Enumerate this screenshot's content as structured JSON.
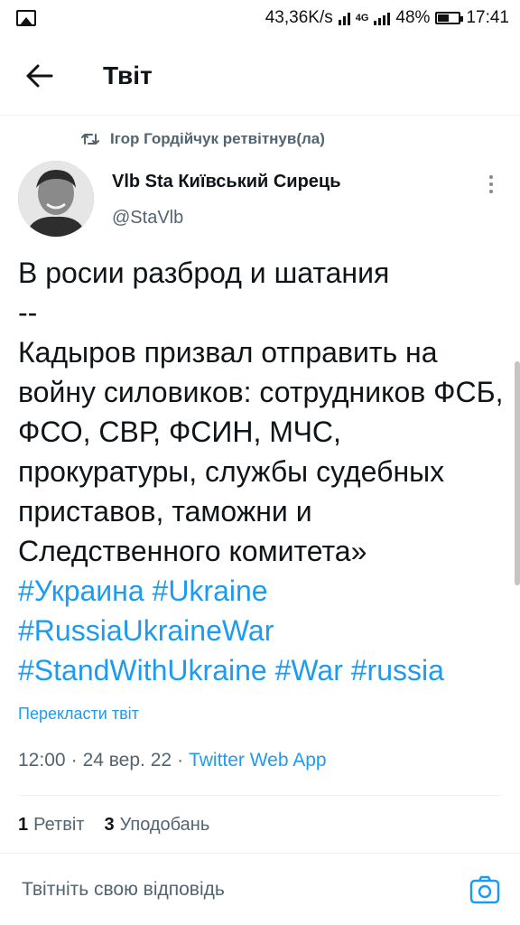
{
  "status_bar": {
    "speed": "43,36K/s",
    "network": "4G",
    "battery": "48%",
    "time": "17:41"
  },
  "header": {
    "title": "Твіт",
    "back_icon": "arrow-left-icon"
  },
  "retweet": {
    "text": "Ігор Гордійчук ретвітнув(ла)",
    "icon": "retweet-icon"
  },
  "author": {
    "name": "Vlb Sta Київський Сирець",
    "handle": "@StaVlb"
  },
  "tweet": {
    "text": "В росии разброд и шатания\n--\nКадыров призвал отправить на войну силовиков: сотрудников ФСБ, ФСО, СВР, ФСИН, МЧС, прокуратуры, службы судебных приставов, таможни и Следственного комитета»",
    "hashtags": {
      "line1": [
        "#Украина",
        "#Ukraine"
      ],
      "line2": [
        "#RussiaUkraineWar"
      ],
      "line3": [
        "#StandWithUkraine",
        "#War",
        "#russia"
      ]
    },
    "translate_label": "Перекласти твіт"
  },
  "meta": {
    "time": "12:00",
    "date": "24 вер. 22",
    "sep": "·",
    "app": "Twitter Web App"
  },
  "stats": {
    "retweets_count": "1",
    "retweets_label": "Ретвіт",
    "likes_count": "3",
    "likes_label": "Уподобань"
  },
  "reply": {
    "placeholder": "Твітніть свою відповідь",
    "camera_icon": "camera-icon"
  },
  "colors": {
    "accent": "#1d9bf0",
    "secondary_text": "#536471",
    "primary_text": "#0f1419"
  }
}
